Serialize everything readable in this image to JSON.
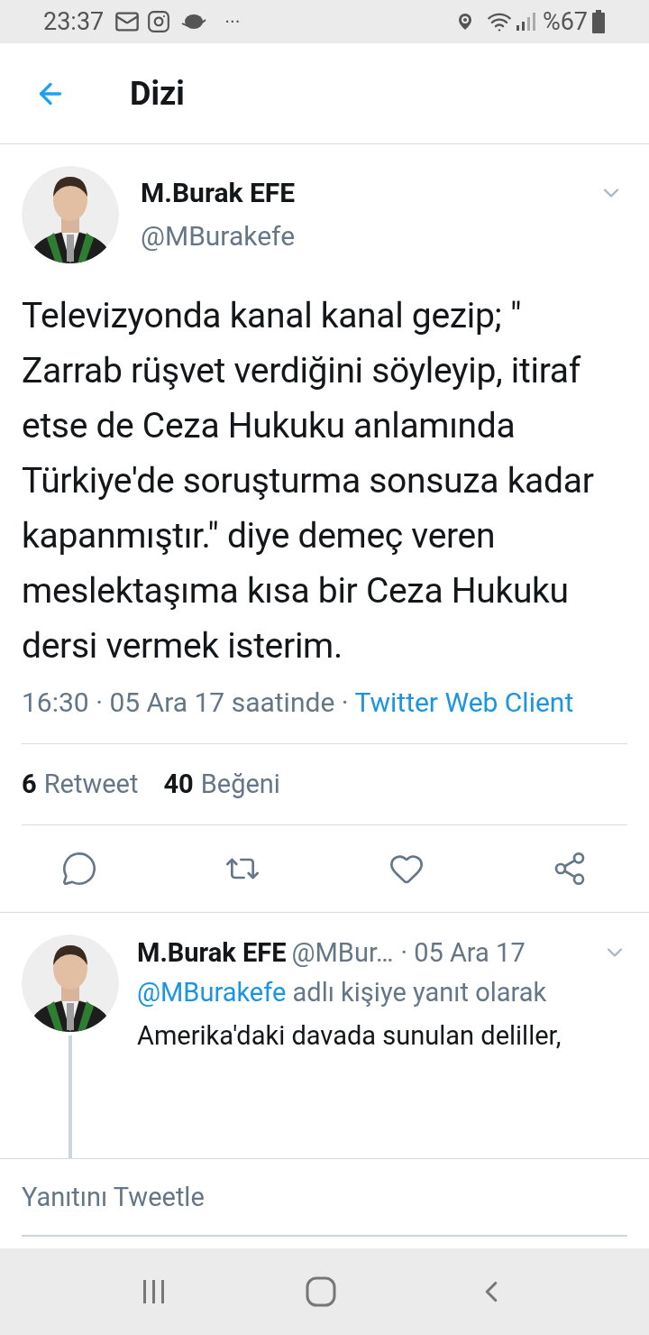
{
  "status_bar": {
    "time": "23:37",
    "more": "···",
    "battery": "%67"
  },
  "header": {
    "title": "Dizi"
  },
  "tweet": {
    "name": "M.Burak EFE",
    "handle": "@MBurakefe",
    "text": "Televizyonda kanal kanal gezip; \" Zarrab rüşvet verdiğini söyleyip, itiraf etse de Ceza Hukuku anlamında Türkiye'de soruşturma sonsuza kadar kapanmıştır.\" diye demeç veren meslektaşıma kısa bir Ceza Hukuku dersi vermek isterim.",
    "time": "16:30 · 05 Ara 17 saatinde · ",
    "source": "Twitter Web Client",
    "stats": [
      {
        "count": "6",
        "label": "Retweet"
      },
      {
        "count": "40",
        "label": "Beğeni"
      }
    ],
    "actions": [
      {
        "kind": "reply"
      },
      {
        "kind": "retweet"
      },
      {
        "kind": "like"
      },
      {
        "kind": "share"
      }
    ]
  },
  "reply": {
    "name": "M.Burak EFE",
    "handle": "@MBur…",
    "date": "· 05 Ara 17",
    "mention": "@MBurakefe",
    "reply_to": " adlı kişiye yanıt olarak",
    "text": "Amerika'daki davada sunulan deliller,"
  },
  "composer": {
    "placeholder": "Yanıtını Tweetle"
  }
}
